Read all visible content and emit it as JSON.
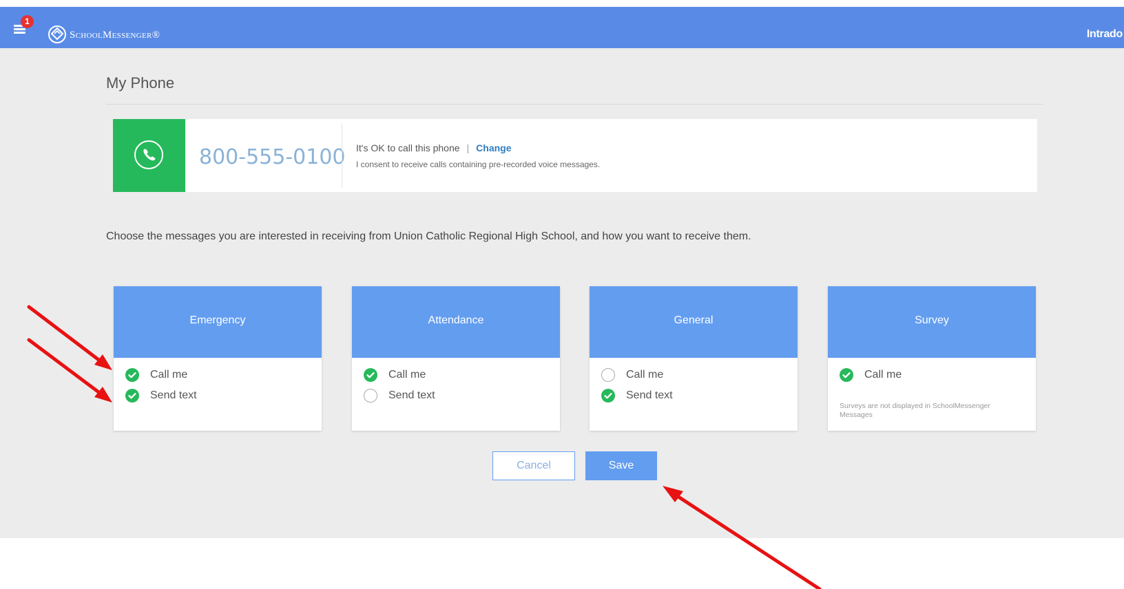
{
  "header": {
    "notification_count": "1",
    "logo_text": "SchoolMessenger®",
    "brand_right": "Intrado",
    "bar_color": "#598be6"
  },
  "page": {
    "title": "My Phone"
  },
  "phone": {
    "number": "800-555-0100",
    "status_text": "It's OK to call this phone",
    "separator": "|",
    "change_label": "Change",
    "consent_text": "I consent to receive calls containing pre-recorded voice messages.",
    "icon": "phone-icon",
    "icon_bg_color": "#26b95b"
  },
  "instructions": "Choose the messages you are interested in receiving from Union Catholic Regional High School, and how you want to receive them.",
  "categories": [
    {
      "title": "Emergency",
      "options": [
        {
          "label": "Call me",
          "checked": true
        },
        {
          "label": "Send text",
          "checked": true
        }
      ]
    },
    {
      "title": "Attendance",
      "options": [
        {
          "label": "Call me",
          "checked": true
        },
        {
          "label": "Send text",
          "checked": false
        }
      ]
    },
    {
      "title": "General",
      "options": [
        {
          "label": "Call me",
          "checked": false
        },
        {
          "label": "Send text",
          "checked": true
        }
      ]
    },
    {
      "title": "Survey",
      "options": [
        {
          "label": "Call me",
          "checked": true
        }
      ],
      "note": "Surveys are not displayed in SchoolMessenger Messages"
    }
  ],
  "buttons": {
    "cancel_label": "Cancel",
    "save_label": "Save"
  },
  "colors": {
    "accent_blue": "#639def",
    "check_green": "#26b95b",
    "annotation_red": "#e81212"
  }
}
